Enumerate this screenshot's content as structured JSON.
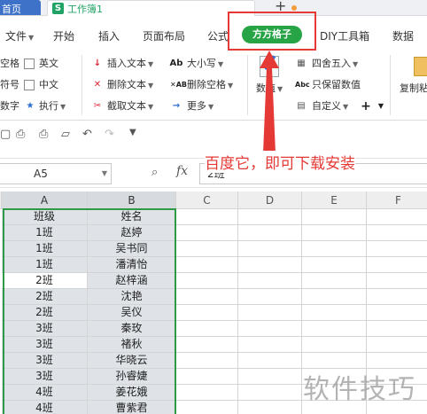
{
  "tabs": {
    "home": "首页",
    "workbook": "工作簿1",
    "workbook_icon": "S",
    "new_tab_icon": "+"
  },
  "menu": {
    "file": "文件",
    "items": [
      "开始",
      "插入",
      "页面布局",
      "公式",
      "方方格子",
      "DIY工具箱",
      "数据"
    ],
    "active": "方方格子"
  },
  "ribbon": {
    "left_col1": [
      "空格",
      "符号",
      "数字"
    ],
    "left_col2": [
      "英文",
      "中文",
      "执行"
    ],
    "text_col1": [
      "插入文本",
      "删除文本",
      "截取文本"
    ],
    "text_col2": [
      "大小写",
      "删除空格",
      "更多"
    ],
    "number_btn": "数值",
    "num_col": [
      "四舍五入",
      "只保留数值",
      "自定义"
    ],
    "copy_btn": "复制粘"
  },
  "formula_bar": {
    "name_box": "A5",
    "fx": "fx",
    "value": "2班"
  },
  "annotation": "百度它，即可下载安装",
  "grid": {
    "columns": [
      "A",
      "B",
      "C",
      "D",
      "E",
      "F"
    ],
    "rows": [
      [
        "班级",
        "姓名"
      ],
      [
        "1班",
        "赵婷"
      ],
      [
        "1班",
        "吴书同"
      ],
      [
        "1班",
        "潘清怡"
      ],
      [
        "2班",
        "赵梓涵"
      ],
      [
        "2班",
        "沈艳"
      ],
      [
        "2班",
        "吴仪"
      ],
      [
        "3班",
        "秦玫"
      ],
      [
        "3班",
        "褚秋"
      ],
      [
        "3班",
        "华晓云"
      ],
      [
        "3班",
        "孙睿婕"
      ],
      [
        "4班",
        "姜花娥"
      ],
      [
        "4班",
        "曹紫君"
      ]
    ]
  },
  "watermark": "软件技巧",
  "colors": {
    "accent_green": "#27a546",
    "range_green": "#2e9a47",
    "annotation_red": "#e53935",
    "home_tab_blue": "#3d72c8"
  }
}
